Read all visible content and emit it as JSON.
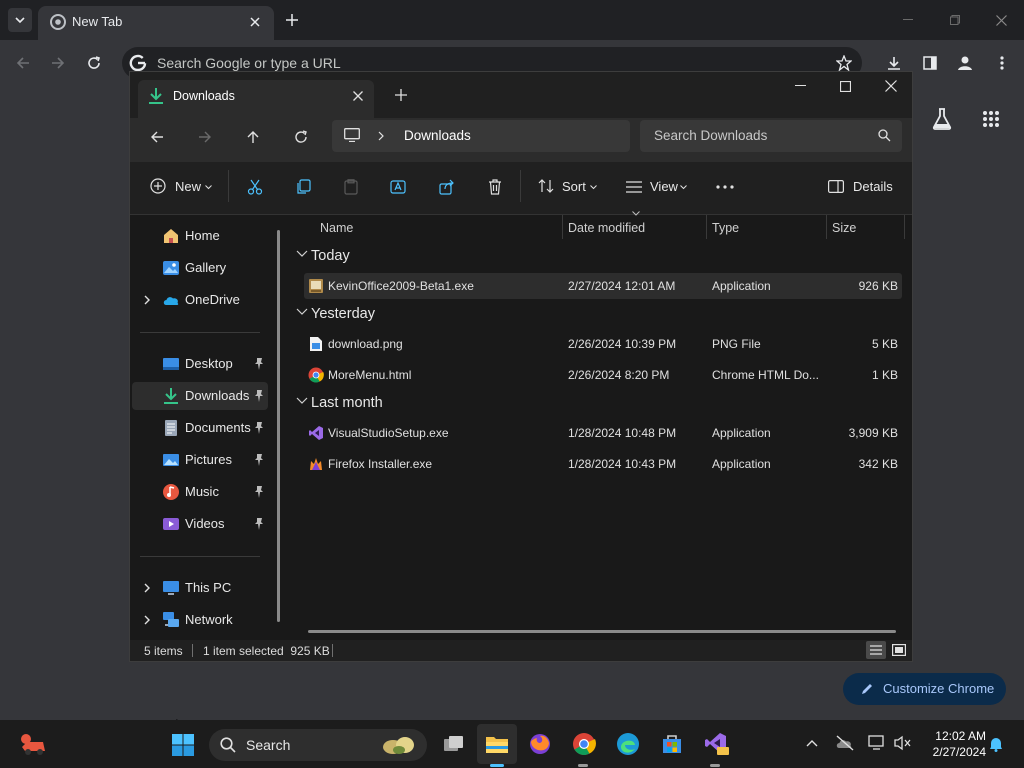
{
  "chrome": {
    "tab_title": "New Tab",
    "omnibox_placeholder": "Search Google or type a URL",
    "customize_label": "Customize Chrome"
  },
  "explorer": {
    "tab_title": "Downloads",
    "breadcrumb": "Downloads",
    "search_placeholder": "Search Downloads",
    "commands": {
      "new": "New",
      "sort": "Sort",
      "view": "View",
      "details": "Details"
    },
    "sidebar": {
      "home": "Home",
      "gallery": "Gallery",
      "onedrive": "OneDrive",
      "desktop": "Desktop",
      "downloads": "Downloads",
      "documents": "Documents",
      "pictures": "Pictures",
      "music": "Music",
      "videos": "Videos",
      "this_pc": "This PC",
      "network": "Network"
    },
    "columns": {
      "name": "Name",
      "date": "Date modified",
      "type": "Type",
      "size": "Size"
    },
    "groups": {
      "today": "Today",
      "yesterday": "Yesterday",
      "last_month": "Last month"
    },
    "files": [
      {
        "name": "KevinOffice2009-Beta1.exe",
        "date": "2/27/2024 12:01 AM",
        "type": "Application",
        "size": "926 KB"
      },
      {
        "name": "download.png",
        "date": "2/26/2024 10:39 PM",
        "type": "PNG File",
        "size": "5 KB"
      },
      {
        "name": "MoreMenu.html",
        "date": "2/26/2024 8:20 PM",
        "type": "Chrome HTML Do...",
        "size": "1 KB"
      },
      {
        "name": "VisualStudioSetup.exe",
        "date": "1/28/2024 10:48 PM",
        "type": "Application",
        "size": "3,909 KB"
      },
      {
        "name": "Firefox Installer.exe",
        "date": "1/28/2024 10:43 PM",
        "type": "Application",
        "size": "342 KB"
      }
    ],
    "status": {
      "items": "5 items",
      "selected": "1 item selected  925 KB"
    }
  },
  "taskbar": {
    "search_label": "Search",
    "time": "12:02 AM",
    "date": "2/27/2024"
  },
  "colors": {
    "accent": "#4cc2ff",
    "chrome_bg": "#35363a",
    "explorer_bg": "#191919"
  }
}
